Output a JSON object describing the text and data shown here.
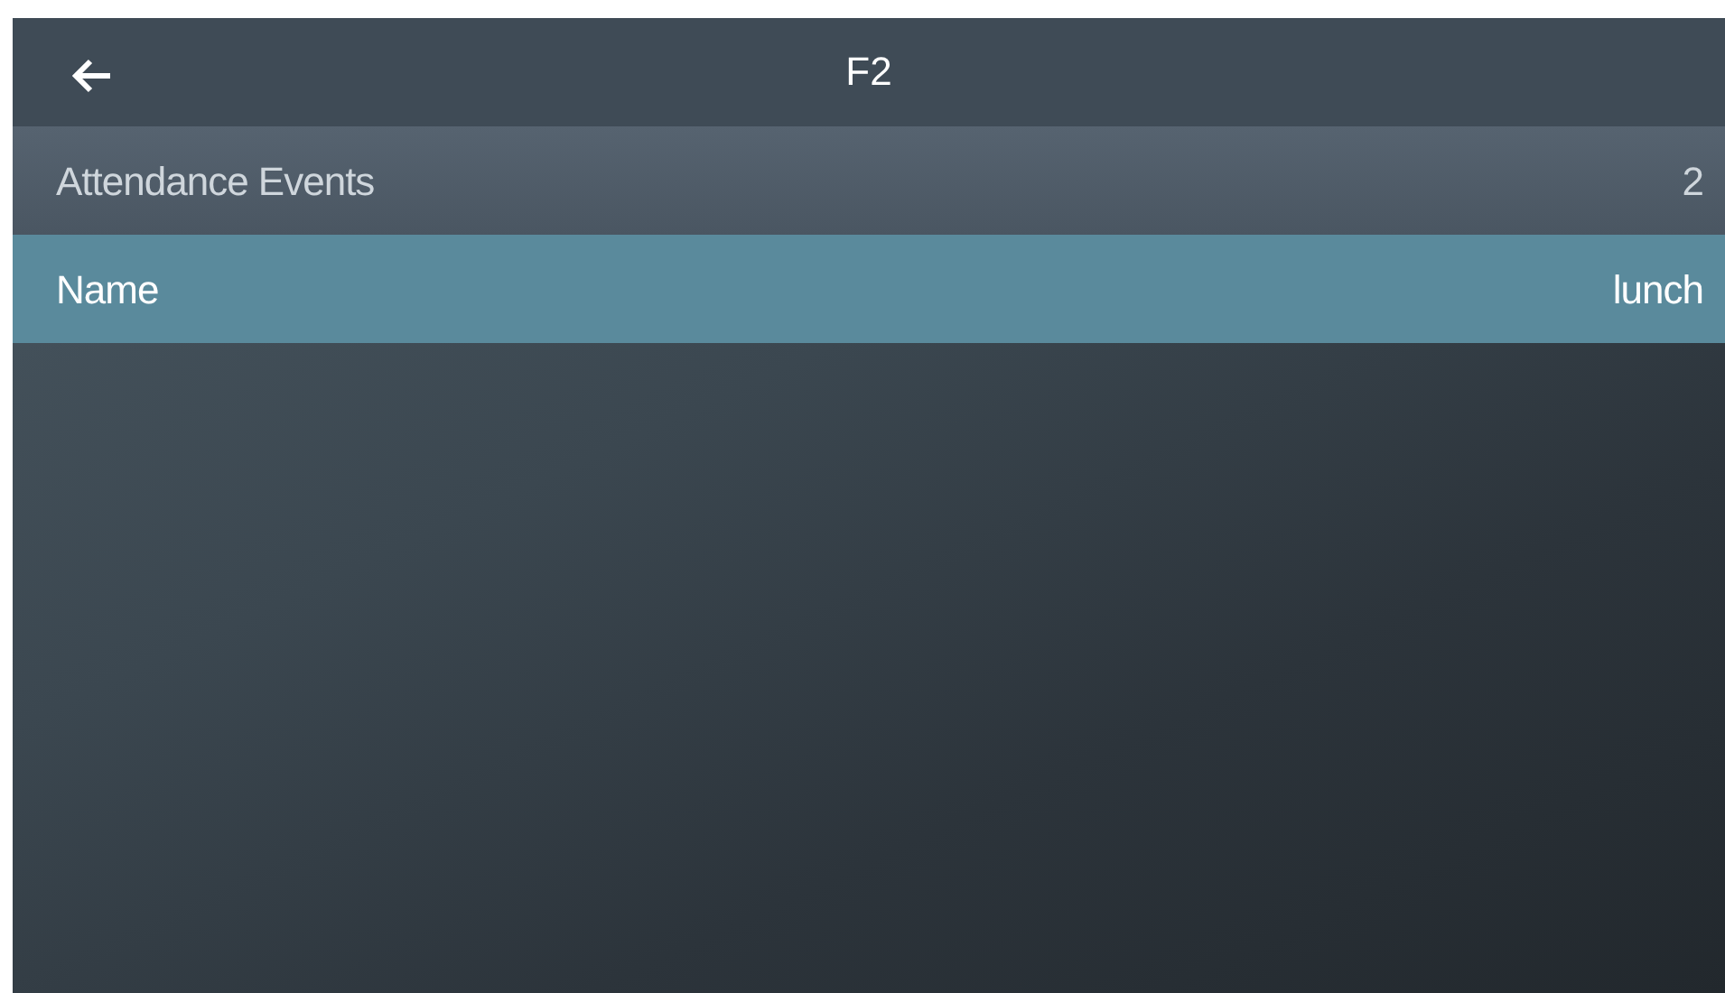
{
  "header": {
    "title": "F2"
  },
  "rows": [
    {
      "label": "Attendance Events",
      "value": "2",
      "selected": false
    },
    {
      "label": "Name",
      "value": "lunch",
      "selected": true
    }
  ]
}
